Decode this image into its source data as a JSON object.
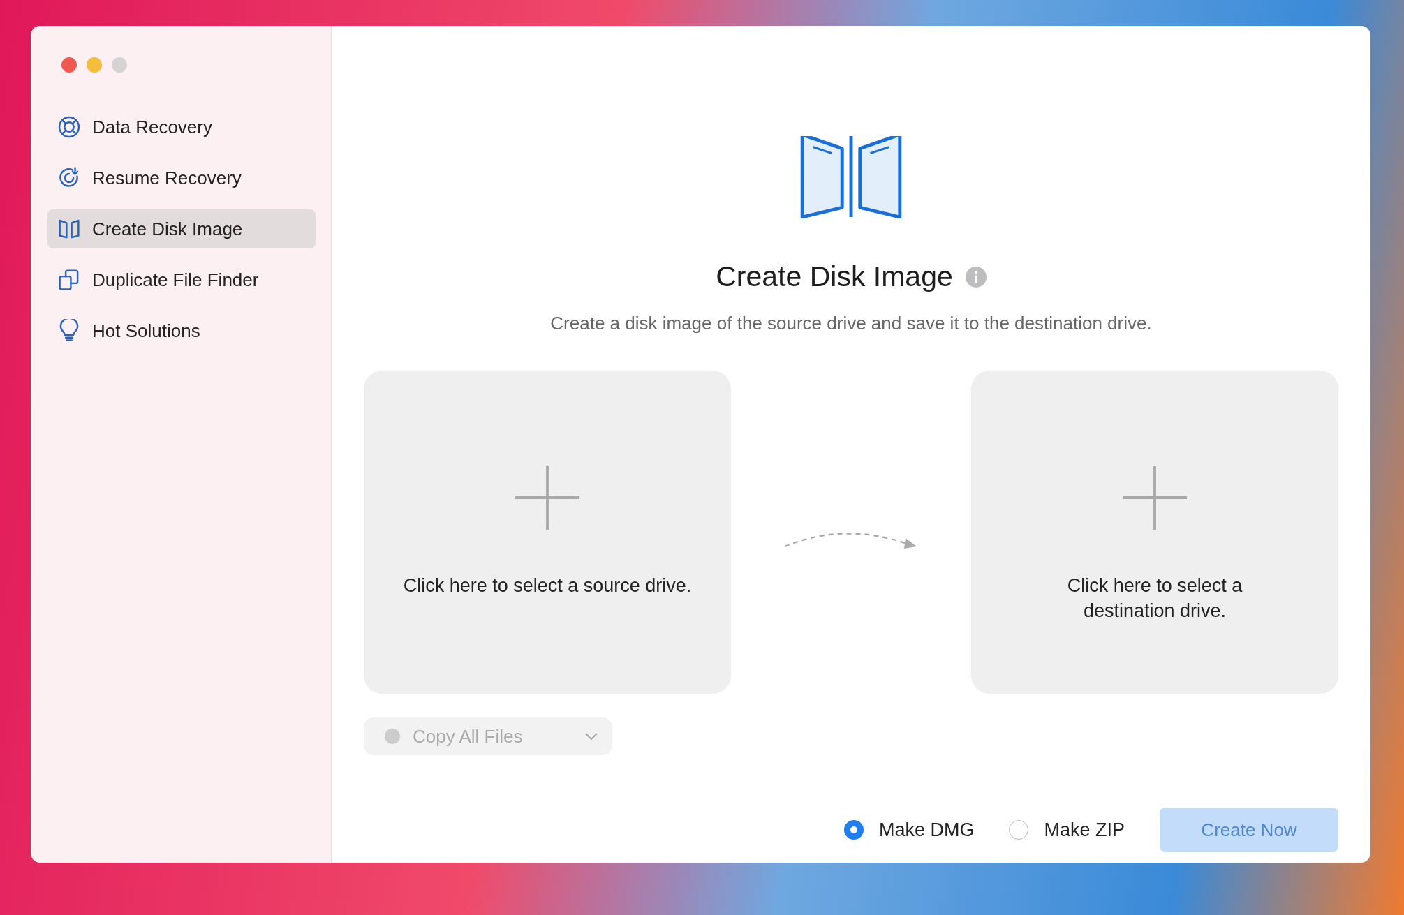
{
  "sidebar": {
    "items": [
      {
        "label": "Data Recovery",
        "selected": false
      },
      {
        "label": "Resume Recovery",
        "selected": false
      },
      {
        "label": "Create Disk Image",
        "selected": true
      },
      {
        "label": "Duplicate File Finder",
        "selected": false
      },
      {
        "label": "Hot Solutions",
        "selected": false
      }
    ]
  },
  "main": {
    "title": "Create Disk Image",
    "subtitle": "Create a disk image of the source drive and save it to the destination drive.",
    "source_card": {
      "label": "Click here to select a source drive."
    },
    "destination_card": {
      "label": "Click here to select a destination drive."
    },
    "copy_dropdown": {
      "value": "Copy All Files",
      "disabled": true
    },
    "formats": [
      {
        "label": "Make DMG",
        "selected": true
      },
      {
        "label": "Make ZIP",
        "selected": false
      }
    ],
    "create_button": {
      "label": "Create Now",
      "disabled": true
    }
  }
}
